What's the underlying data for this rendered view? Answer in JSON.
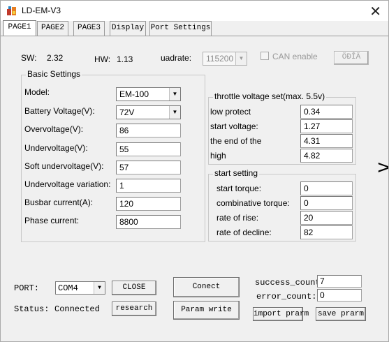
{
  "window": {
    "title": "LD-EM-V3",
    "close_glyph": "✕"
  },
  "tabs": [
    {
      "label": "PAGE1",
      "active": true
    },
    {
      "label": "PAGE2"
    },
    {
      "label": "PAGE3"
    },
    {
      "label": "Display"
    },
    {
      "label": "Port Settings"
    }
  ],
  "info": {
    "sw_label": "SW:",
    "sw_value": "2.32",
    "hw_label": "HW:",
    "hw_value": "1.13",
    "quadrate_label": "uadrate:",
    "quadrate_value": "115200",
    "can_label": "CAN enable",
    "can_button": "ÖÐÎÄ"
  },
  "basic_settings": {
    "title": "Basic Settings",
    "model_label": "Model:",
    "model_value": "EM-100",
    "battery_label": "Battery Voltage(V):",
    "battery_value": "72V",
    "overvoltage_label": "Overvoltage(V):",
    "overvoltage_value": "86",
    "undervoltage_label": "Undervoltage(V):",
    "undervoltage_value": "55",
    "soft_undervoltage_label": "Soft undervoltage(V):",
    "soft_undervoltage_value": "57",
    "undervoltage_variation_label": "Undervoltage variation:",
    "undervoltage_variation_value": "1",
    "busbar_label": "Busbar current(A):",
    "busbar_value": "120",
    "phase_label": "Phase current:",
    "phase_value": "8800"
  },
  "throttle": {
    "title": "throttle voltage set(max. 5.5v)",
    "low_label": "low protect",
    "low_value": "0.34",
    "start_label": "start voltage:",
    "start_value": "1.27",
    "end_label": "the end of the",
    "end_value": "4.31",
    "high_label": "high",
    "high_value": "4.82"
  },
  "start_setting": {
    "title": "start setting",
    "torque_label": "start torque:",
    "torque_value": "0",
    "comb_label": "combinative torque:",
    "comb_value": "0",
    "rise_label": "rate of rise:",
    "rise_value": "20",
    "decline_label": "rate of decline:",
    "decline_value": "82"
  },
  "nav": {
    "next_glyph": ">"
  },
  "bottom": {
    "port_label": "PORT:",
    "port_value": "COM4",
    "close_button": "CLOSE",
    "status_label": "Status:",
    "status_value": "Connected",
    "research_button": "research",
    "conect_button": "Conect",
    "param_write_button": "Param write",
    "success_label": "success_count:",
    "success_value": "7",
    "error_label": "error_count:",
    "error_value": "0",
    "import_button": "import prarm",
    "save_button": "save prarm"
  }
}
